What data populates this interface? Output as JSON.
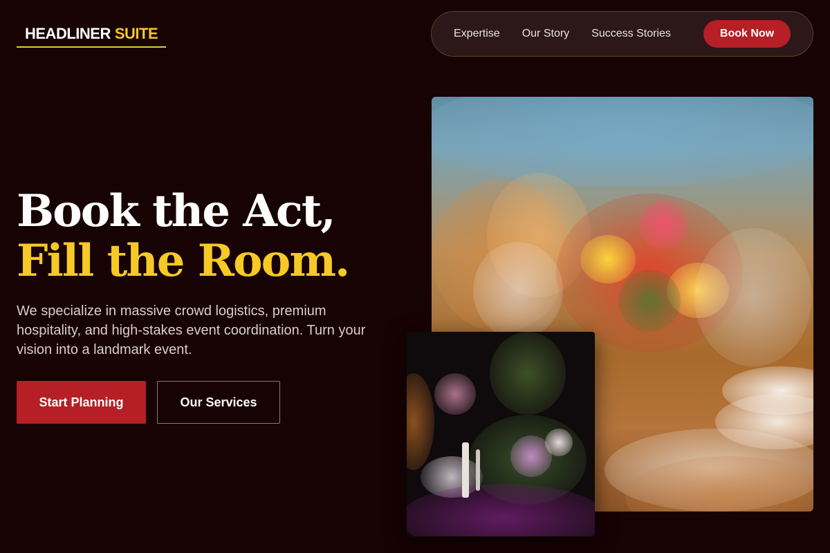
{
  "brand": {
    "part1": "HEADLINER",
    "part2": "SUITE"
  },
  "nav": {
    "links": [
      "Expertise",
      "Our Story",
      "Success Stories"
    ],
    "cta": "Book Now"
  },
  "hero": {
    "headline_line1": "Book the Act,",
    "headline_line2": "Fill the Room.",
    "description": "We specialize in massive crowd logistics, premium hospitality, and high-stakes event coordination. Turn your vision into a landmark event.",
    "primary_button": "Start Planning",
    "secondary_button": "Our Services"
  },
  "colors": {
    "background": "#170204",
    "accent_red": "#b51f25",
    "accent_gold": "#f6c925"
  }
}
